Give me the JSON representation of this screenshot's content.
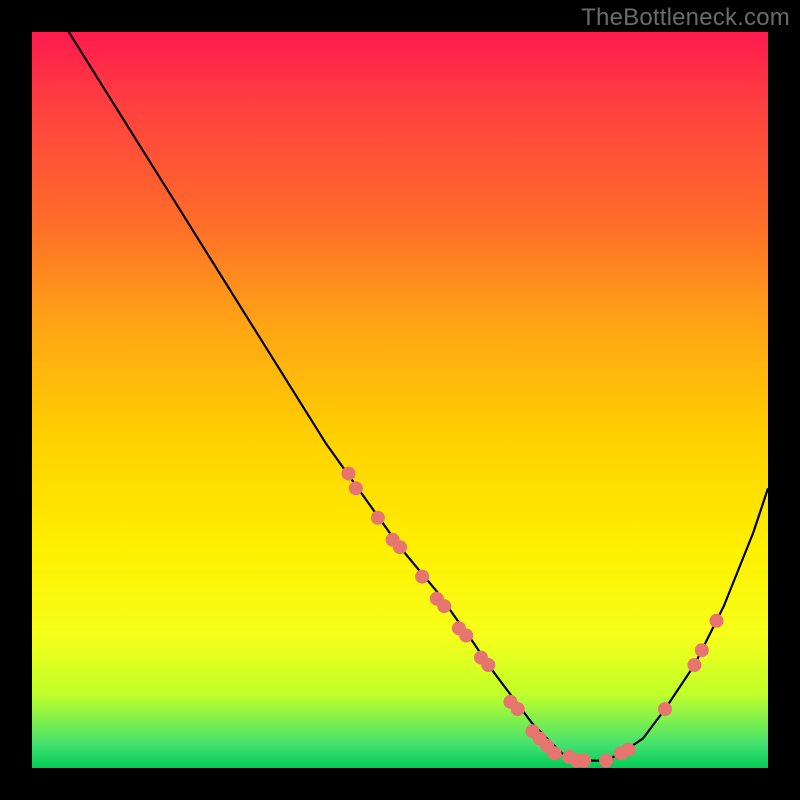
{
  "watermark": "TheBottleneck.com",
  "colors": {
    "background": "#000000",
    "gradient_top": "#ff1a4d",
    "gradient_bottom": "#00cc55",
    "curve": "#000000",
    "marker_fill": "#e6756f",
    "marker_stroke": "#aa3b35"
  },
  "chart_data": {
    "type": "line",
    "title": "",
    "xlabel": "",
    "ylabel": "",
    "xlim": [
      0,
      100
    ],
    "ylim": [
      0,
      100
    ],
    "grid": false,
    "series": [
      {
        "name": "bottleneck-curve",
        "x": [
          5,
          10,
          15,
          20,
          25,
          30,
          35,
          40,
          45,
          50,
          55,
          60,
          62,
          65,
          68,
          70,
          72,
          75,
          78,
          80,
          83,
          86,
          90,
          94,
          98,
          100
        ],
        "y": [
          100,
          92,
          84,
          76,
          68,
          60,
          52,
          44,
          37,
          30,
          24,
          17,
          14,
          10,
          6,
          4,
          2,
          1,
          1,
          2,
          4,
          8,
          14,
          22,
          32,
          38
        ]
      }
    ],
    "markers": [
      {
        "x": 43,
        "y": 40
      },
      {
        "x": 44,
        "y": 38
      },
      {
        "x": 47,
        "y": 34
      },
      {
        "x": 49,
        "y": 31
      },
      {
        "x": 50,
        "y": 30
      },
      {
        "x": 53,
        "y": 26
      },
      {
        "x": 55,
        "y": 23
      },
      {
        "x": 56,
        "y": 22
      },
      {
        "x": 58,
        "y": 19
      },
      {
        "x": 59,
        "y": 18
      },
      {
        "x": 61,
        "y": 15
      },
      {
        "x": 62,
        "y": 14
      },
      {
        "x": 65,
        "y": 9
      },
      {
        "x": 66,
        "y": 8
      },
      {
        "x": 68,
        "y": 5
      },
      {
        "x": 69,
        "y": 4
      },
      {
        "x": 70,
        "y": 3
      },
      {
        "x": 71,
        "y": 2
      },
      {
        "x": 73,
        "y": 1.5
      },
      {
        "x": 74,
        "y": 1
      },
      {
        "x": 75,
        "y": 1
      },
      {
        "x": 78,
        "y": 1
      },
      {
        "x": 80,
        "y": 2
      },
      {
        "x": 81,
        "y": 2.5
      },
      {
        "x": 86,
        "y": 8
      },
      {
        "x": 90,
        "y": 14
      },
      {
        "x": 91,
        "y": 16
      },
      {
        "x": 93,
        "y": 20
      }
    ]
  }
}
